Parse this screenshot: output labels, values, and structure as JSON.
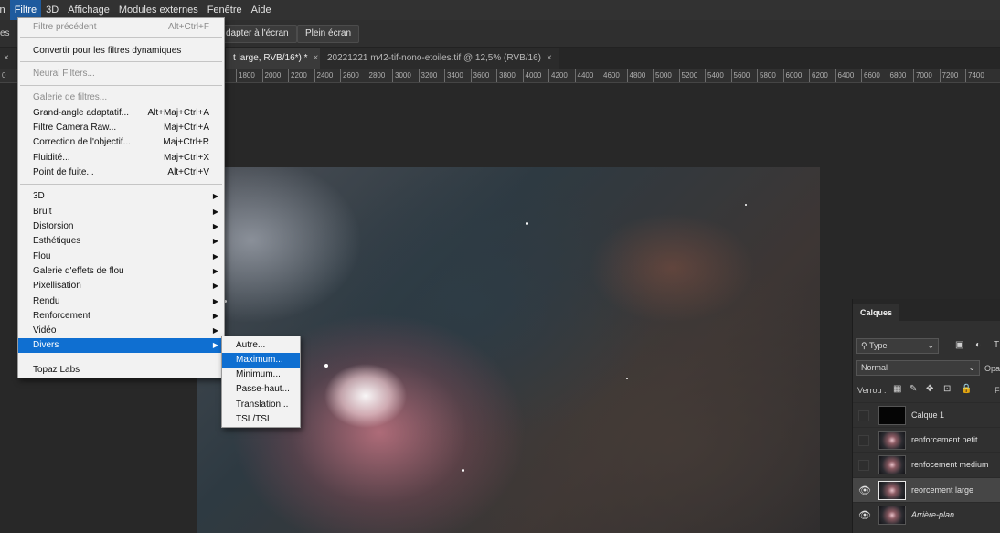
{
  "menubar": {
    "items": [
      "ion",
      "Filtre",
      "3D",
      "Affichage",
      "Modules externes",
      "Fenêtre",
      "Aide"
    ]
  },
  "options_bar": {
    "left_text": "es",
    "fit_screen": "dapter à l'écran",
    "full_screen": "Plein écran"
  },
  "tabs": [
    {
      "label": "t large, RVB/16*) *",
      "close": "×"
    },
    {
      "label": "20221221 m42-tif-nono-etoiles.tif @ 12,5% (RVB/16)",
      "close": "×"
    }
  ],
  "tabs_left_close": "×",
  "ruler": {
    "zero": "0",
    "ticks": [
      "1800",
      "2000",
      "2200",
      "2400",
      "2600",
      "2800",
      "3000",
      "3200",
      "3400",
      "3600",
      "3800",
      "4000",
      "4200",
      "4400",
      "4600",
      "4800",
      "5000",
      "5200",
      "5400",
      "5600",
      "5800",
      "6000",
      "6200",
      "6400",
      "6600",
      "6800",
      "7000",
      "7200",
      "7400"
    ]
  },
  "filtre_menu": {
    "previous_filter": {
      "label": "Filtre précédent",
      "shortcut": "Alt+Ctrl+F"
    },
    "smart_filters": "Convertir pour les filtres dynamiques",
    "neural_filters": "Neural Filters...",
    "gallery": "Galerie de filtres...",
    "items_with_shortcut": [
      {
        "label": "Grand-angle adaptatif...",
        "shortcut": "Alt+Maj+Ctrl+A"
      },
      {
        "label": "Filtre Camera Raw...",
        "shortcut": "Maj+Ctrl+A"
      },
      {
        "label": "Correction de l'objectif...",
        "shortcut": "Maj+Ctrl+R"
      },
      {
        "label": "Fluidité...",
        "shortcut": "Maj+Ctrl+X"
      },
      {
        "label": "Point de fuite...",
        "shortcut": "Alt+Ctrl+V"
      }
    ],
    "submenus": [
      "3D",
      "Bruit",
      "Distorsion",
      "Esthétiques",
      "Flou",
      "Galerie d'effets de flou",
      "Pixellisation",
      "Rendu",
      "Renforcement",
      "Vidéo",
      "Divers"
    ],
    "topaz": "Topaz Labs",
    "arrow": "▶"
  },
  "divers_submenu": [
    "Autre...",
    "Maximum...",
    "Minimum...",
    "Passe-haut...",
    "Translation...",
    "TSL/TSI"
  ],
  "layers_panel": {
    "tab": "Calques",
    "filter_type": "Type",
    "blend_mode": "Normal",
    "opacity_label": "Opa",
    "lock_label": "Verrou :",
    "fill_label": "Fo",
    "layers": [
      {
        "name": "Calque 1",
        "visible": false
      },
      {
        "name": "renforcement  petit",
        "visible": false
      },
      {
        "name": "renfocement medium",
        "visible": false
      },
      {
        "name": "reorcement large",
        "visible": true,
        "selected": true
      },
      {
        "name": "Arrière-plan",
        "visible": true
      }
    ],
    "eye_glyph": "👁"
  }
}
